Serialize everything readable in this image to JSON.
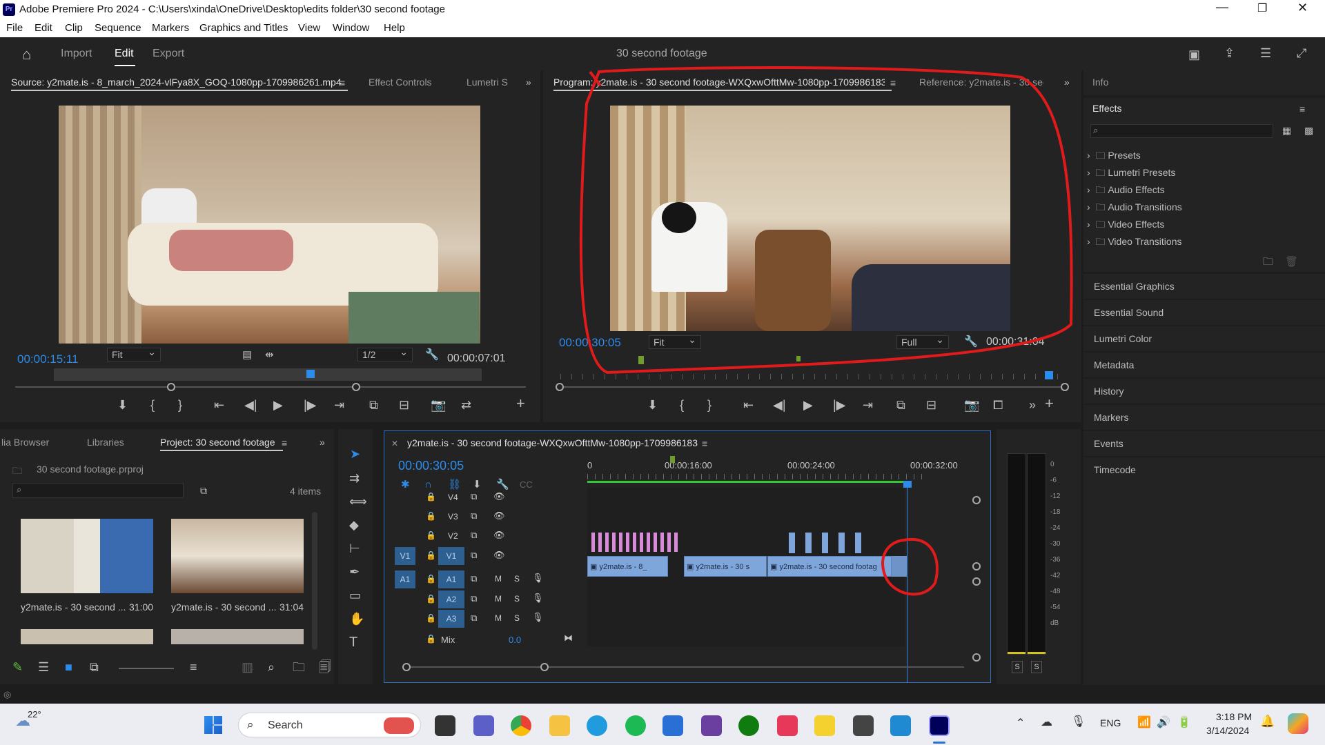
{
  "window": {
    "title": "Adobe Premiere Pro 2024 - C:\\Users\\xinda\\OneDrive\\Desktop\\edits folder\\30 second footage",
    "app_icon": "Pr"
  },
  "menu": [
    "File",
    "Edit",
    "Clip",
    "Sequence",
    "Markers",
    "Graphics and Titles",
    "View",
    "Window",
    "Help"
  ],
  "workspace": {
    "tabs": [
      "Import",
      "Edit",
      "Export"
    ],
    "active": "Edit",
    "project_title": "30 second footage"
  },
  "source_monitor": {
    "tabs": [
      "Source: y2mate.is - 8_march_2024-vlFya8X_GOQ-1080pp-1709986261.mp4",
      "Effect Controls",
      "Lumetri S"
    ],
    "timecode": "00:00:15:11",
    "fit": "Fit",
    "resolution": "1/2",
    "duration": "00:00:07:01",
    "playhead_fraction": 0.6
  },
  "program_monitor": {
    "tabs": [
      "Program: y2mate.is - 30 second footage-WXQxwOfttMw-1080pp-1709986183",
      "Reference: y2mate.is - 30 sec"
    ],
    "timecode": "00:00:30:05",
    "fit": "Fit",
    "quality": "Full",
    "duration": "00:00:31:04",
    "playhead_fraction": 0.97
  },
  "project_panel": {
    "tabs": [
      "lia Browser",
      "Libraries",
      "Project: 30 second footage"
    ],
    "project_file": "30 second footage.prproj",
    "item_count": "4 items",
    "items": [
      {
        "name": "y2mate.is - 30 second ...",
        "duration": "31:00"
      },
      {
        "name": "y2mate.is - 30 second ...",
        "duration": "31:04"
      }
    ]
  },
  "timeline": {
    "sequence_name": "y2mate.is - 30 second footage-WXQxwOfttMw-1080pp-1709986183",
    "timecode": "00:00:30:05",
    "ruler_labels": [
      "0",
      "00:00:16:00",
      "00:00:24:00",
      "00:00:32:00"
    ],
    "video_tracks": [
      "V4",
      "V3",
      "V2",
      "V1"
    ],
    "audio_tracks": [
      "A1",
      "A2",
      "A3"
    ],
    "source_v": "V1",
    "source_a": "A1",
    "track_buttons": {
      "mute": "M",
      "solo": "S"
    },
    "mix_label": "Mix",
    "mix_value": "0.0",
    "clips": [
      {
        "label": "y2mate.is - 8_"
      },
      {
        "label": "y2mate.is - 30 s"
      },
      {
        "label": "y2mate.is - 30 second footag"
      }
    ]
  },
  "audio_meter": {
    "scale": [
      "0",
      "-6",
      "-12",
      "-18",
      "-24",
      "-30",
      "-36",
      "-42",
      "-48",
      "-54",
      "dB"
    ],
    "solo": [
      "S",
      "S"
    ]
  },
  "right_panels": {
    "info": "Info",
    "effects": {
      "title": "Effects",
      "folders": [
        "Presets",
        "Lumetri Presets",
        "Audio Effects",
        "Audio Transitions",
        "Video Effects",
        "Video Transitions"
      ]
    },
    "collapsed": [
      "Essential Graphics",
      "Essential Sound",
      "Lumetri Color",
      "Metadata",
      "History",
      "Markers",
      "Events",
      "Timecode"
    ]
  },
  "taskbar": {
    "weather": "22°",
    "search": "Search",
    "lang": "ENG",
    "time": "3:18 PM",
    "date": "3/14/2024"
  },
  "colors": {
    "accent_blue": "#2d8ceb",
    "annotation_red": "#e01b1b",
    "clip_blue": "#7fa6db",
    "clip_pink": "#d98ad9"
  }
}
